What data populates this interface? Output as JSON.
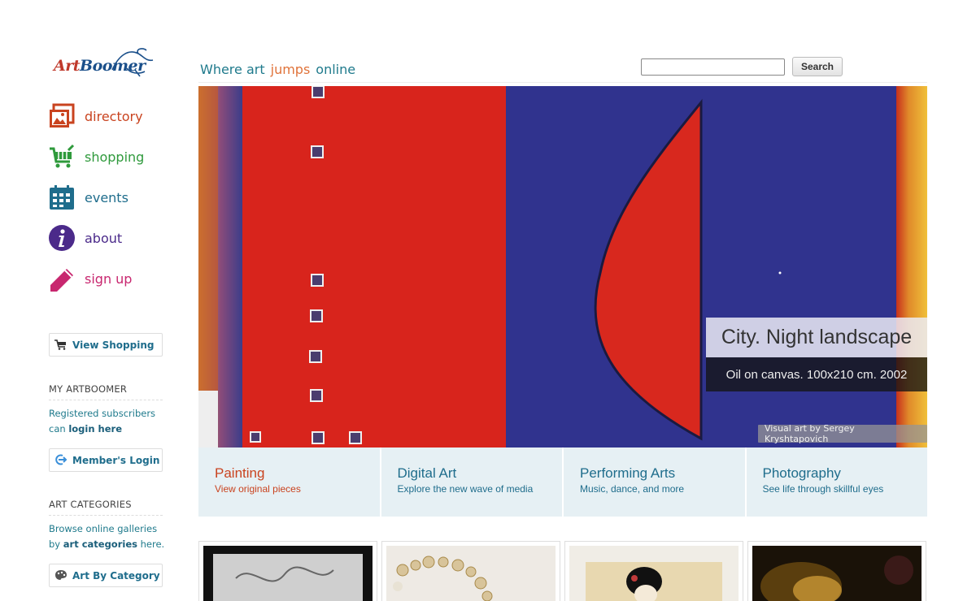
{
  "logo": {
    "part1": "Art",
    "part2": "Boomer"
  },
  "nav": [
    {
      "label": "directory",
      "icon": "gallery-icon",
      "color": "#c9431f"
    },
    {
      "label": "shopping",
      "icon": "shopping-cart-icon",
      "color": "#2f9a3c"
    },
    {
      "label": "events",
      "icon": "calendar-icon",
      "color": "#1f6d8c"
    },
    {
      "label": "about",
      "icon": "info-icon",
      "color": "#4b2a8a"
    },
    {
      "label": "sign up",
      "icon": "pencil-icon",
      "color": "#c8276f"
    }
  ],
  "shopping_button": "View Shopping",
  "my_artboomer": {
    "title": "MY ARTBOOMER",
    "text_before": "Registered subscribers can ",
    "link": "login here",
    "button": "Member's Login"
  },
  "art_categories": {
    "title": "ART CATEGORIES",
    "text_before": "Browse online galleries by ",
    "link": "art categories",
    "text_after": " here.",
    "button": "Art By Category"
  },
  "tagline": [
    {
      "text": "Where art",
      "color": "#1f7a8c"
    },
    {
      "text": "jumps",
      "color": "#e0733a"
    },
    {
      "text": "online",
      "color": "#1f7a8c"
    }
  ],
  "search": {
    "button": "Search",
    "value": ""
  },
  "hero": {
    "title": "City. Night landscape",
    "subtitle": "Oil on canvas. 100x210 cm. 2002",
    "credit": "Visual art by Sergey Kryshtapovich"
  },
  "categories": [
    {
      "title": "Painting",
      "subtitle": "View original pieces",
      "color": "#c9431f"
    },
    {
      "title": "Digital Art",
      "subtitle": "Explore the new wave of media",
      "color": "#1f6d8c"
    },
    {
      "title": "Performing Arts",
      "subtitle": "Music, dance, and more",
      "color": "#1f6d8c"
    },
    {
      "title": "Photography",
      "subtitle": "See life through skillful eyes",
      "color": "#1f6d8c"
    }
  ],
  "colors": {
    "accent_teal": "#1f7a8c",
    "accent_orange": "#e0733a",
    "tile_bg": "#e6f0f4"
  }
}
